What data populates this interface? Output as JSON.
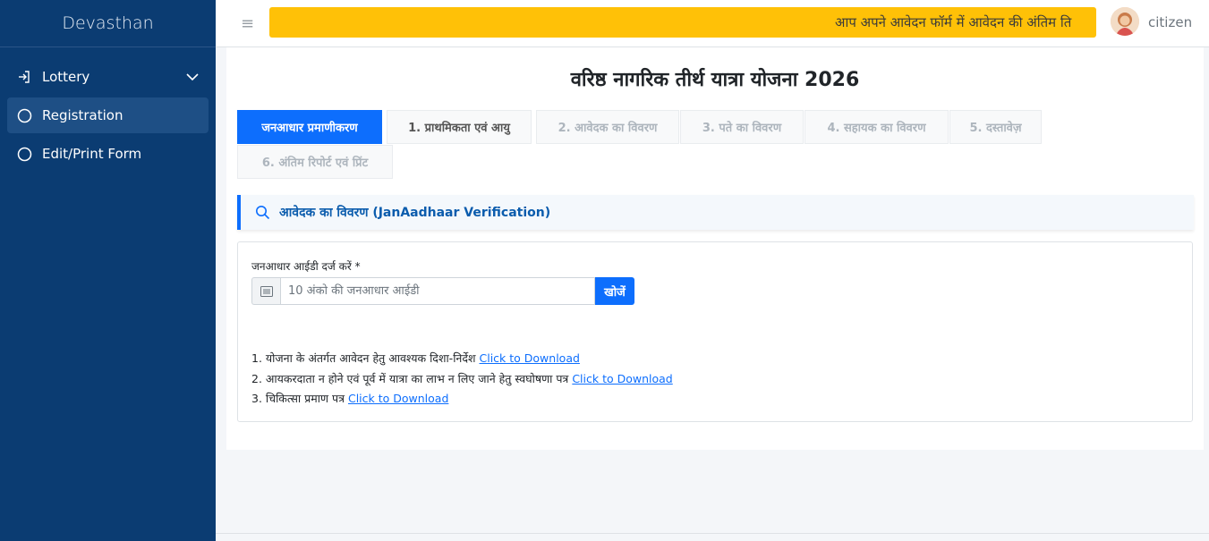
{
  "sidebar": {
    "brand": "Devasthan",
    "items": [
      {
        "label": "Lottery",
        "icon": "login-arrow-icon"
      },
      {
        "label": "Registration",
        "icon": "circle-icon"
      },
      {
        "label": "Edit/Print Form",
        "icon": "circle-icon"
      }
    ]
  },
  "topbar": {
    "marquee": "आप अपने आवेदन फॉर्म में आवेदन की अंतिम ति",
    "username": "citizen",
    "accent": "#ffc107"
  },
  "page": {
    "title": "वरिष्ठ नागरिक तीर्थ यात्रा योजना 2026"
  },
  "tabs": [
    {
      "label": "जनआधार प्रमाणीकरण"
    },
    {
      "label": "1. प्राथमिकता एवं आयु"
    },
    {
      "label": "2. आवेदक का विवरण"
    },
    {
      "label": "3. पते का विवरण"
    },
    {
      "label": "4. सहायक का विवरण"
    },
    {
      "label": "5. दस्तावेज़"
    },
    {
      "label": "6. अंतिम रिपोर्ट एवं प्रिंट"
    }
  ],
  "section": {
    "title": "आवेदक का विवरण (JanAadhaar Verification)"
  },
  "form": {
    "label": "जनआधार आईडी दर्ज करें *",
    "placeholder": "10 अंको की जनआधार आईडी",
    "search_label": "खोजें"
  },
  "documents": [
    {
      "text": "1. योजना के अंतर्गत आवेदन हेतु आवश्यक दिशा-निर्देश",
      "link": "Click to Download"
    },
    {
      "text": "2. आयकरदाता न होने एवं पूर्व में यात्रा का लाभ न लिए जाने हेतु स्वघोषणा पत्र",
      "link": "Click to Download"
    },
    {
      "text": "3. चिकित्सा प्रमाण पत्र",
      "link": "Click to Download"
    }
  ],
  "colors": {
    "sidebar": "#0b3c72",
    "primary": "#0d6efd"
  }
}
